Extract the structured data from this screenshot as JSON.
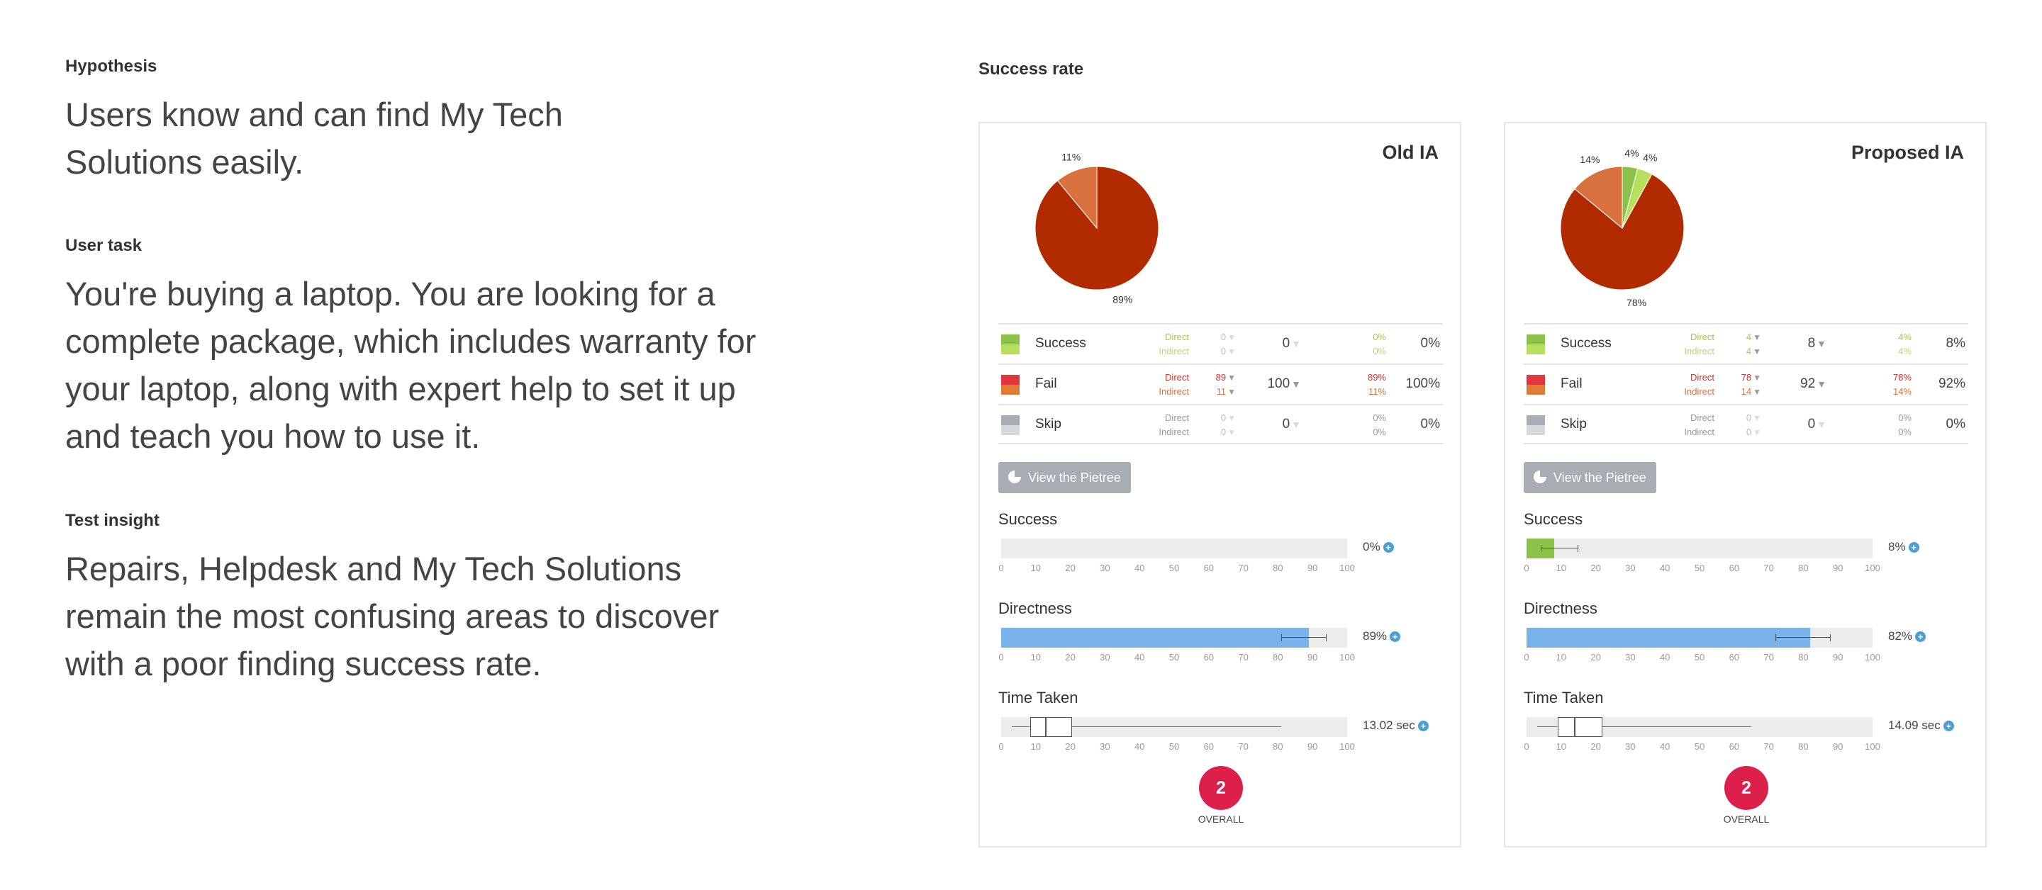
{
  "hypothesis": {
    "label": "Hypothesis",
    "text": "Users know and can find My Tech Solutions easily."
  },
  "user_task": {
    "label": "User task",
    "text": "You're buying a laptop. You are looking for a complete package, which includes warranty for your laptop, along with expert help to set it up and teach you how to use it."
  },
  "test_insight": {
    "label": "Test insight",
    "text": "Repairs, Helpdesk and My Tech Solutions remain the most confusing areas to discover with a poor finding success rate."
  },
  "success_rate_title": "Success rate",
  "colors": {
    "success": "#8bc34a",
    "success_light": "#b6e05b",
    "fail": "#b22a00",
    "fail_light": "#d9713e",
    "skip": "#a7adb2",
    "skip_light": "#d5d9dc",
    "directness": "#7ab3ec",
    "overall": "#dd1f4b"
  },
  "direct_label": "Direct",
  "indirect_label": "Indirect",
  "pietree_label": "View the Pietree",
  "success_label": "Success",
  "directness_label": "Directness",
  "time_label": "Time Taken",
  "overall_label": "OVERALL",
  "axis_ticks": [
    "0",
    "10",
    "20",
    "30",
    "40",
    "50",
    "60",
    "70",
    "80",
    "90",
    "100"
  ],
  "cards": {
    "old": {
      "title": "Old IA",
      "pie": {
        "slices": [
          {
            "label": "89%",
            "value": 89,
            "color": "#b22a00"
          },
          {
            "label": "11%",
            "value": 11,
            "color": "#d9713e"
          }
        ]
      },
      "rows": {
        "success": {
          "name": "Success",
          "direct": "0",
          "indirect": "0",
          "total": "0",
          "direct_pct": "0%",
          "indirect_pct": "0%",
          "total_pct": "0%"
        },
        "fail": {
          "name": "Fail",
          "direct": "89",
          "indirect": "11",
          "total": "100",
          "direct_pct": "89%",
          "indirect_pct": "11%",
          "total_pct": "100%"
        },
        "skip": {
          "name": "Skip",
          "direct": "0",
          "indirect": "0",
          "total": "0",
          "direct_pct": "0%",
          "indirect_pct": "0%",
          "total_pct": "0%"
        }
      },
      "success_bar": {
        "value": 0,
        "display": "0%"
      },
      "directness_bar": {
        "value": 89,
        "err_low": 81,
        "err_high": 94,
        "display": "89%"
      },
      "time_taken": {
        "whisker_low": 3,
        "q1": 8.5,
        "median": 13,
        "q3": 20.5,
        "whisker_high": 81,
        "display": "13.02 sec"
      },
      "overall": "2"
    },
    "new": {
      "title": "Proposed IA",
      "pie": {
        "slices": [
          {
            "label": "78%",
            "value": 78,
            "color": "#b22a00"
          },
          {
            "label": "14%",
            "value": 14,
            "color": "#d9713e"
          },
          {
            "label": "4%",
            "value": 4,
            "color": "#8bc34a"
          },
          {
            "label": "4%",
            "value": 4,
            "color": "#b6e05b"
          }
        ]
      },
      "rows": {
        "success": {
          "name": "Success",
          "direct": "4",
          "indirect": "4",
          "total": "8",
          "direct_pct": "4%",
          "indirect_pct": "4%",
          "total_pct": "8%"
        },
        "fail": {
          "name": "Fail",
          "direct": "78",
          "indirect": "14",
          "total": "92",
          "direct_pct": "78%",
          "indirect_pct": "14%",
          "total_pct": "92%"
        },
        "skip": {
          "name": "Skip",
          "direct": "0",
          "indirect": "0",
          "total": "0",
          "direct_pct": "0%",
          "indirect_pct": "0%",
          "total_pct": "0%"
        }
      },
      "success_bar": {
        "value": 8,
        "err_low": 4,
        "err_high": 15,
        "display": "8%"
      },
      "directness_bar": {
        "value": 82,
        "err_low": 72,
        "err_high": 88,
        "display": "82%"
      },
      "time_taken": {
        "whisker_low": 3,
        "q1": 9,
        "median": 14,
        "q3": 22,
        "whisker_high": 65,
        "display": "14.09 sec"
      },
      "overall": "2"
    }
  }
}
